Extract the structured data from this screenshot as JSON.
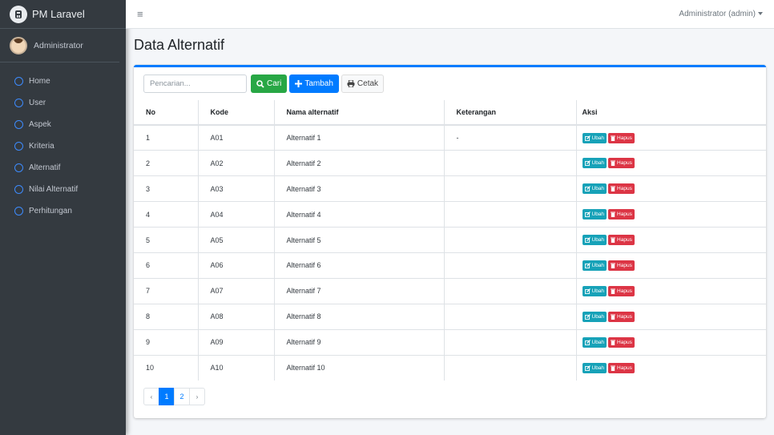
{
  "brand": {
    "name": "PM Laravel"
  },
  "user_panel": {
    "name": "Administrator"
  },
  "sidebar": {
    "items": [
      {
        "label": "Home"
      },
      {
        "label": "User"
      },
      {
        "label": "Aspek"
      },
      {
        "label": "Kriteria"
      },
      {
        "label": "Alternatif"
      },
      {
        "label": "Nilai Alternatif"
      },
      {
        "label": "Perhitungan"
      }
    ]
  },
  "topbar": {
    "menu_icon": "≡",
    "user_menu": "Administrator (admin)"
  },
  "page": {
    "title": "Data Alternatif"
  },
  "toolbar": {
    "search_placeholder": "Pencarian...",
    "search_button": "Cari",
    "add_button": "Tambah",
    "print_button": "Cetak"
  },
  "table": {
    "headers": [
      "No",
      "Kode",
      "Nama alternatif",
      "Keterangan",
      "Aksi"
    ],
    "edit_label": "Ubah",
    "delete_label": "Hapus",
    "rows": [
      {
        "no": "1",
        "kode": "A01",
        "nama": "Alternatif 1",
        "ket": "-"
      },
      {
        "no": "2",
        "kode": "A02",
        "nama": "Alternatif 2",
        "ket": ""
      },
      {
        "no": "3",
        "kode": "A03",
        "nama": "Alternatif 3",
        "ket": ""
      },
      {
        "no": "4",
        "kode": "A04",
        "nama": "Alternatif 4",
        "ket": ""
      },
      {
        "no": "5",
        "kode": "A05",
        "nama": "Alternatif 5",
        "ket": ""
      },
      {
        "no": "6",
        "kode": "A06",
        "nama": "Alternatif 6",
        "ket": ""
      },
      {
        "no": "7",
        "kode": "A07",
        "nama": "Alternatif 7",
        "ket": ""
      },
      {
        "no": "8",
        "kode": "A08",
        "nama": "Alternatif 8",
        "ket": ""
      },
      {
        "no": "9",
        "kode": "A09",
        "nama": "Alternatif 9",
        "ket": ""
      },
      {
        "no": "10",
        "kode": "A10",
        "nama": "Alternatif 10",
        "ket": ""
      }
    ]
  },
  "pagination": {
    "prev": "‹",
    "next": "›",
    "pages": [
      "1",
      "2"
    ],
    "active": "1"
  },
  "colors": {
    "primary": "#007bff",
    "success": "#28a745",
    "info": "#17a2b8",
    "danger": "#dc3545",
    "sidebar": "#343a40"
  }
}
